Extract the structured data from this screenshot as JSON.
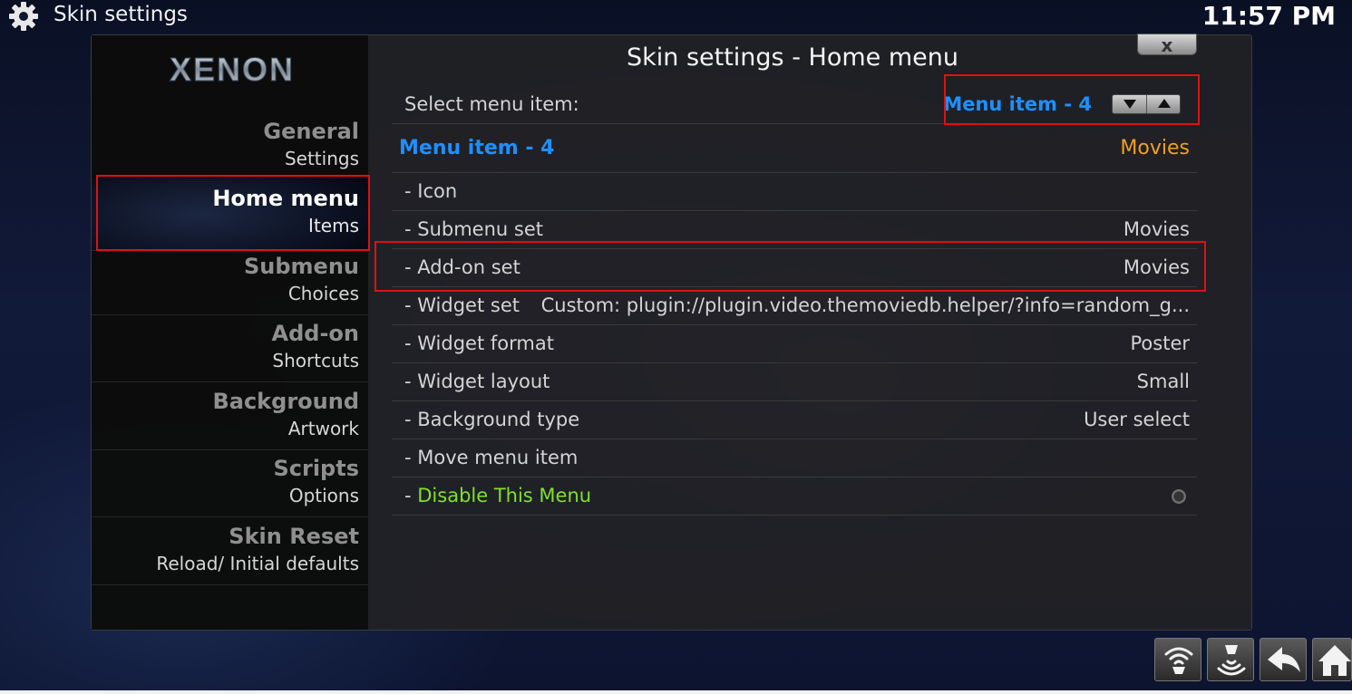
{
  "window": {
    "title": "Skin settings",
    "clock": "11:57 PM"
  },
  "logo": "XENON",
  "dialog": {
    "title": "Skin settings - Home menu",
    "close_label": "x"
  },
  "sidebar": {
    "items": [
      {
        "title": "General",
        "subtitle": "Settings"
      },
      {
        "title": "Home menu",
        "subtitle": "Items"
      },
      {
        "title": "Submenu",
        "subtitle": "Choices"
      },
      {
        "title": "Add-on",
        "subtitle": "Shortcuts"
      },
      {
        "title": "Background",
        "subtitle": "Artwork"
      },
      {
        "title": "Scripts",
        "subtitle": "Options"
      },
      {
        "title": "Skin Reset",
        "subtitle": "Reload/ Initial defaults"
      }
    ],
    "active_index": 1
  },
  "selector": {
    "label": "Select menu item:",
    "value": "Menu item - 4"
  },
  "header_row": {
    "label": "Menu item - 4",
    "value": "Movies"
  },
  "rows": [
    {
      "label": "- Icon",
      "value": ""
    },
    {
      "label": "- Submenu set",
      "value": "Movies"
    },
    {
      "label": "- Add-on set",
      "value": "Movies"
    },
    {
      "label": "- Widget set",
      "value": "Custom: plugin://plugin.video.themoviedb.helper/?info=random_g..."
    },
    {
      "label": "- Widget format",
      "value": "Poster"
    },
    {
      "label": "- Widget layout",
      "value": "Small"
    },
    {
      "label": "- Background type",
      "value": "User select"
    },
    {
      "label": "- Move menu item",
      "value": ""
    }
  ],
  "disable_row": {
    "prefix": "- ",
    "label": "Disable This Menu",
    "toggle_on": false
  },
  "colors": {
    "accent_blue": "#1e8fff",
    "value_orange": "#f0a020",
    "toggle_green": "#7fe12a",
    "highlight_red": "#e01010"
  },
  "bottom_buttons": [
    "wifi-icon",
    "network-icon",
    "back-icon",
    "home-icon"
  ]
}
